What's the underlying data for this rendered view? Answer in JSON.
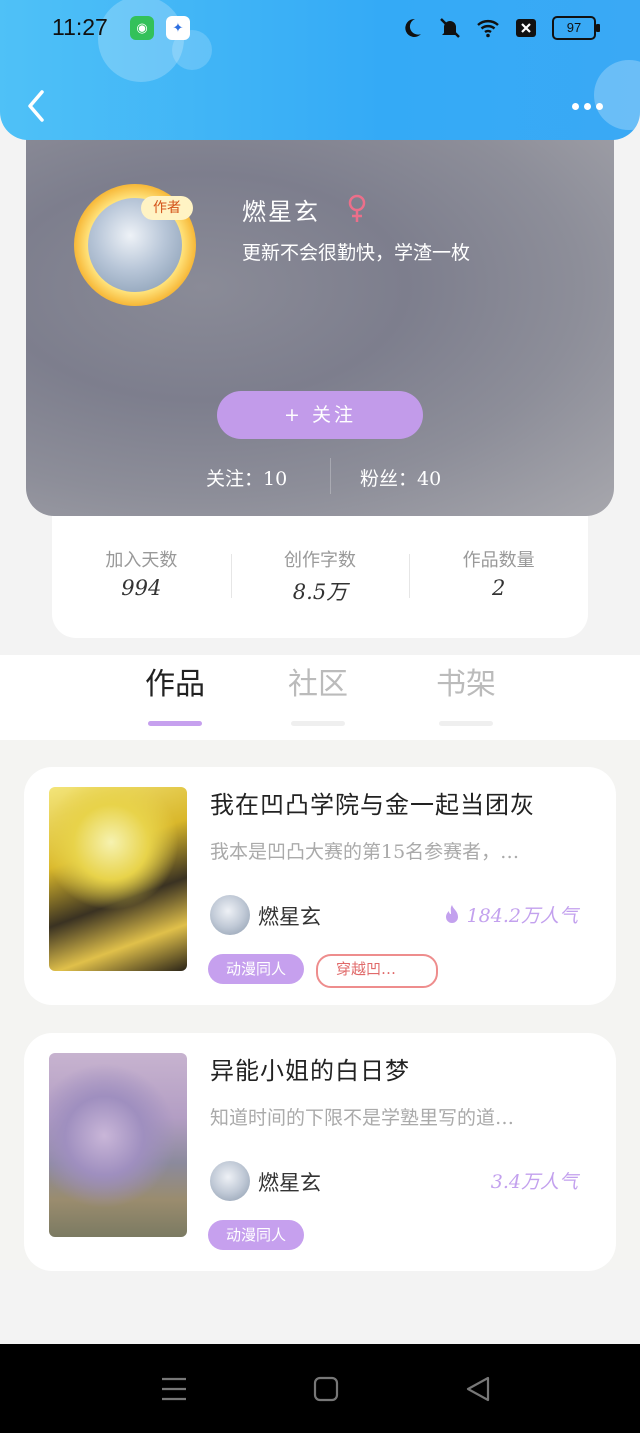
{
  "status_bar": {
    "time": "11:27",
    "battery": "97",
    "icons": [
      "green-app-icon",
      "baidu-app-icon",
      "moon-icon",
      "bell-muted-icon",
      "wifi-icon",
      "sim-x-icon",
      "battery-icon"
    ]
  },
  "header": {
    "back_icon": "chevron-left-icon",
    "more_icon": "more-dots-icon"
  },
  "profile": {
    "badge": "作者",
    "name": "燃星玄",
    "gender": "♀",
    "bio": "更新不会很勤快，学渣一枚",
    "follow_button": "+  关注",
    "following": "关注：10",
    "followers": "粉丝：40"
  },
  "stats": [
    {
      "label": "加入天数",
      "value": "994"
    },
    {
      "label": "创作字数",
      "value": "8.5万"
    },
    {
      "label": "作品数量",
      "value": "2"
    }
  ],
  "tabs": [
    {
      "label": "作品",
      "active": true
    },
    {
      "label": "社区",
      "active": false
    },
    {
      "label": "书架",
      "active": false
    }
  ],
  "works": [
    {
      "title": "我在凹凸学院与金一起当团灰",
      "desc": "我本是凹凸大赛的第15名参赛者，…",
      "author": "燃星玄",
      "popularity": "184.2万人气",
      "tags": [
        "动漫同人",
        "穿越凹…"
      ]
    },
    {
      "title": "异能小姐的白日梦",
      "desc": "知道时间的下限不是学塾里写的道…",
      "author": "燃星玄",
      "popularity": "3.4万人气",
      "tags": [
        "动漫同人"
      ]
    }
  ],
  "colors": {
    "accent": "#c6a0ee",
    "header_blue": "#3aa9f5",
    "tag_red": "#e06a6a"
  }
}
